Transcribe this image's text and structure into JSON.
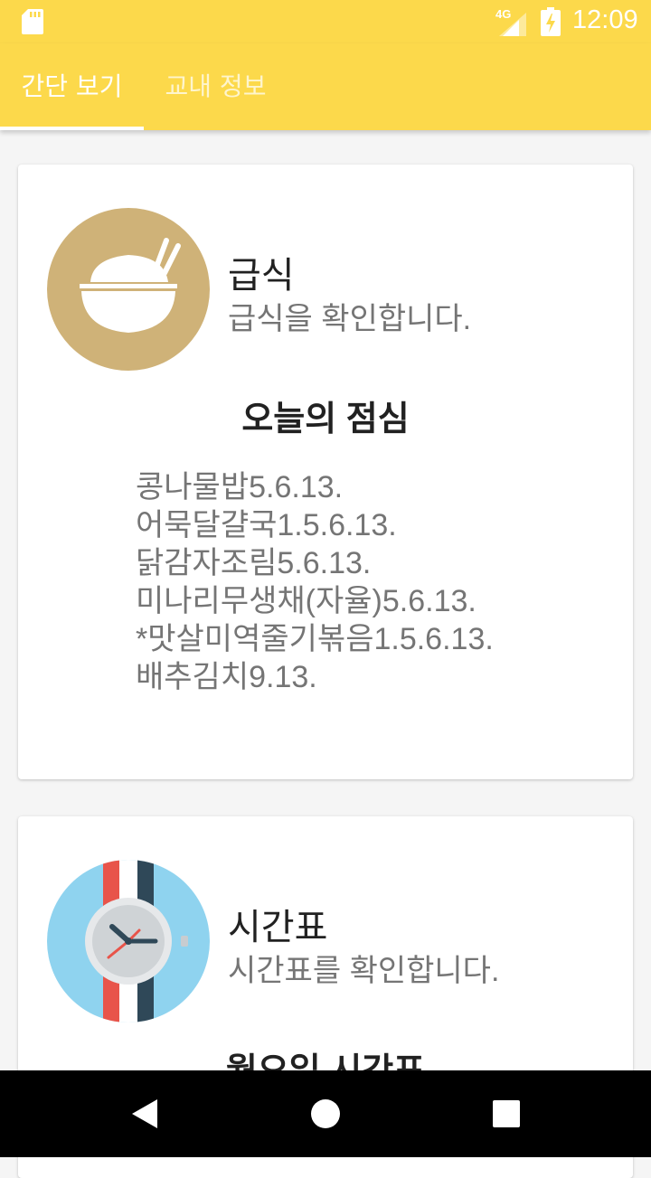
{
  "status_bar": {
    "network": "4G",
    "time": "12:09"
  },
  "tabs": [
    {
      "label": "간단 보기",
      "selected": true
    },
    {
      "label": "교내 정보",
      "selected": false
    }
  ],
  "cards": {
    "meal": {
      "icon": "rice-bowl-icon",
      "title": "급식",
      "subtitle": "급식을 확인합니다.",
      "heading": "오늘의 점심",
      "items": [
        "콩나물밥5.6.13.",
        "어묵달걀국1.5.6.13.",
        "닭감자조림5.6.13.",
        "미나리무생채(자율)5.6.13.",
        "*맛살미역줄기볶음1.5.6.13.",
        "배추김치9.13."
      ]
    },
    "timetable": {
      "icon": "watch-icon",
      "title": "시간표",
      "subtitle": "시간표를 확인합니다.",
      "heading": "월요일 시간표"
    }
  },
  "colors": {
    "accent": "#fcd94b",
    "meal_icon_bg": "#cfb278",
    "watch_icon_bg": "#8fd3ef"
  },
  "nav_bar": {
    "buttons": [
      "back-icon",
      "home-icon",
      "recents-icon"
    ]
  }
}
